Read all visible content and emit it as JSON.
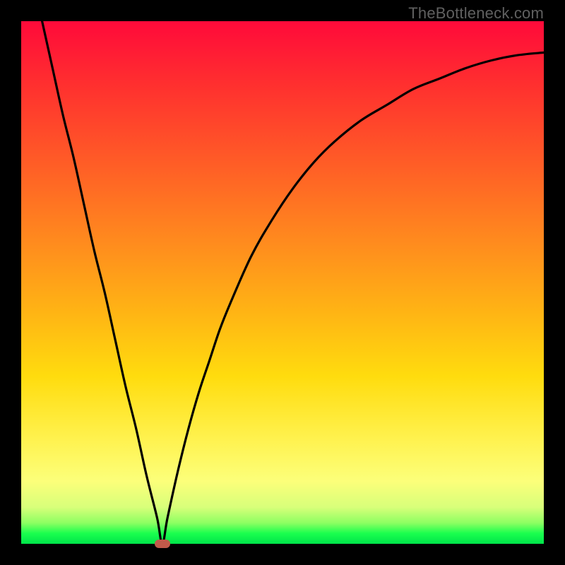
{
  "watermark": "TheBottleneck.com",
  "chart_data": {
    "type": "line",
    "title": "",
    "xlabel": "",
    "ylabel": "",
    "xlim": [
      0,
      100
    ],
    "ylim": [
      0,
      100
    ],
    "grid": false,
    "series": [
      {
        "name": "bottleneck-curve",
        "x": [
          4,
          6,
          8,
          10,
          12,
          14,
          16,
          18,
          20,
          22,
          24,
          26,
          27,
          28,
          30,
          32,
          34,
          36,
          38,
          40,
          44,
          48,
          52,
          56,
          60,
          65,
          70,
          75,
          80,
          85,
          90,
          95,
          100
        ],
        "values": [
          100,
          91,
          82,
          74,
          65,
          56,
          48,
          39,
          30,
          22,
          13,
          5,
          0,
          5,
          14,
          22,
          29,
          35,
          41,
          46,
          55,
          62,
          68,
          73,
          77,
          81,
          84,
          87,
          89,
          91,
          92.5,
          93.5,
          94
        ]
      }
    ],
    "annotations": {
      "minimum_point": {
        "x": 27,
        "y": 0
      }
    },
    "background_gradient": {
      "type": "vertical",
      "stops": [
        {
          "pos": 0.0,
          "color": "#ff0a3a"
        },
        {
          "pos": 0.28,
          "color": "#ff5f26"
        },
        {
          "pos": 0.56,
          "color": "#ffb514"
        },
        {
          "pos": 0.8,
          "color": "#fff24f"
        },
        {
          "pos": 0.96,
          "color": "#8dff62"
        },
        {
          "pos": 1.0,
          "color": "#00e44a"
        }
      ]
    }
  }
}
